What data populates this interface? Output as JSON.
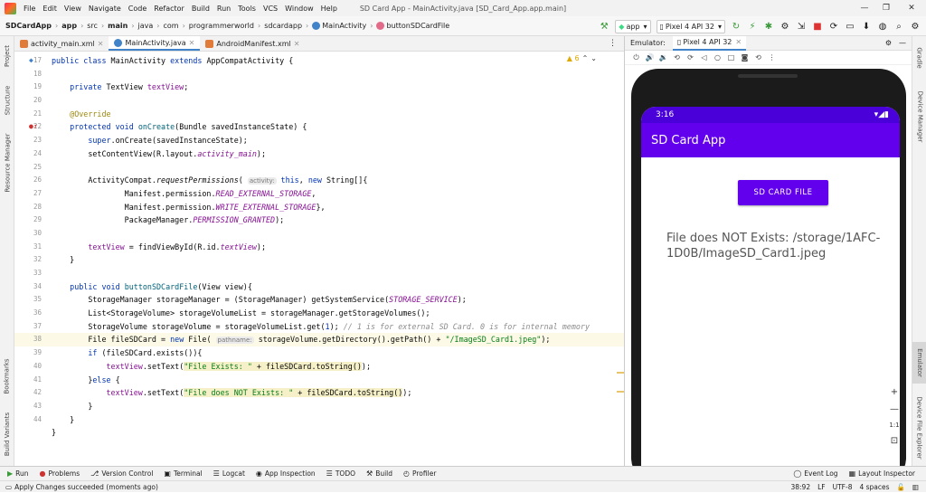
{
  "window": {
    "title": "SD Card App - MainActivity.java [SD_Card_App.app.main]",
    "minimize": "—",
    "maximize": "❐",
    "close": "✕"
  },
  "menu": [
    "File",
    "Edit",
    "View",
    "Navigate",
    "Code",
    "Refactor",
    "Build",
    "Run",
    "Tools",
    "VCS",
    "Window",
    "Help"
  ],
  "breadcrumbs": [
    "SDCardApp",
    "app",
    "src",
    "main",
    "java",
    "com",
    "programmerworld",
    "sdcardapp",
    "MainActivity",
    "buttonSDCardFile"
  ],
  "toolbar": {
    "run_config": "app",
    "device": "Pixel 4 API 32"
  },
  "left_tools": [
    "Project",
    "Structure",
    "Resource Manager",
    "Bookmarks",
    "Build Variants"
  ],
  "right_tools": [
    "Gradle",
    "Device Manager",
    "Emulator",
    "Device File Explorer"
  ],
  "file_tabs": [
    {
      "label": "activity_main.xml",
      "active": false,
      "color": "#e07b39"
    },
    {
      "label": "MainActivity.java",
      "active": true,
      "color": "#4083c9"
    },
    {
      "label": "AndroidManifest.xml",
      "active": false,
      "color": "#e07b39"
    }
  ],
  "editor": {
    "warnings": "▲ 6",
    "hint_activity": "activity:",
    "hint_pathname": "pathname:",
    "line_numbers": [
      "17",
      "18",
      "19",
      "20",
      "21",
      "22",
      "23",
      "24",
      "25",
      "26",
      "27",
      "28",
      "29",
      "30",
      "31",
      "32",
      "33",
      "34",
      "35",
      "36",
      "37",
      "38",
      "39",
      "40",
      "41",
      "42",
      "43",
      "44"
    ]
  },
  "emulator": {
    "panel_label": "Emulator:",
    "tab_label": "Pixel 4 API 32",
    "status_time": "3:16",
    "status_icons": "▾◢▮",
    "app_title": "SD Card App",
    "button_label": "SD CARD FILE",
    "output_text": "File does NOT Exists: /storage/1AFC-1D0B/ImageSD_Card1.jpeg",
    "zoom_controls": [
      "+",
      "—",
      "1:1",
      "⊡"
    ]
  },
  "bottom_tools": [
    {
      "icon": "▶",
      "label": "Run"
    },
    {
      "icon": "●",
      "label": "Problems"
    },
    {
      "icon": "⎇",
      "label": "Version Control"
    },
    {
      "icon": "▣",
      "label": "Terminal"
    },
    {
      "icon": "☰",
      "label": "Logcat"
    },
    {
      "icon": "◉",
      "label": "App Inspection"
    },
    {
      "icon": "☰",
      "label": "TODO"
    },
    {
      "icon": "⚒",
      "label": "Build"
    },
    {
      "icon": "◴",
      "label": "Profiler"
    },
    {
      "icon": "◯",
      "label": "Event Log"
    },
    {
      "icon": "▦",
      "label": "Layout Inspector"
    }
  ],
  "status": {
    "message": "Apply Changes succeeded (moments ago)",
    "position": "38:92",
    "line_sep": "LF",
    "encoding": "UTF-8",
    "indent": "4 spaces"
  },
  "colors": {
    "accent": "#6200ee",
    "status_bar": "#4a00d8",
    "ide_tab_underline": "#4083c9"
  }
}
